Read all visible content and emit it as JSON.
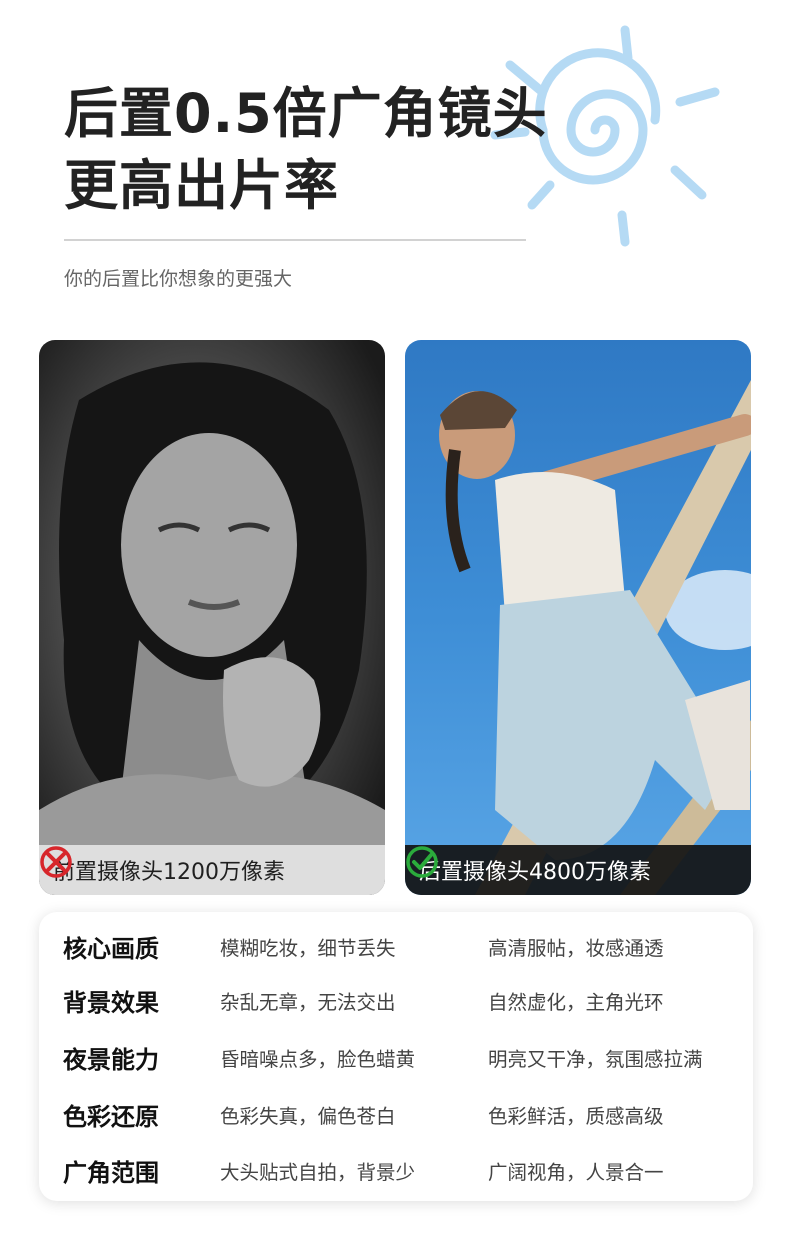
{
  "title": {
    "line1": "后置0.5倍广角镜头",
    "line2": "更高出片率"
  },
  "subtitle": "你的后置比你想象的更强大",
  "photos": {
    "left": {
      "caption": "前置摄像头1200万像素",
      "icon": "cross-mark-icon"
    },
    "right": {
      "caption": "后置摄像头4800万像素",
      "icon": "check-mark-icon"
    }
  },
  "comparison": [
    {
      "label": "核心画质",
      "front": "模糊吃妆，细节丢失",
      "rear": "高清服帖，妆感通透"
    },
    {
      "label": "背景效果",
      "front": "杂乱无章，无法交出",
      "rear": "自然虚化，主角光环"
    },
    {
      "label": "夜景能力",
      "front": "昏暗噪点多，脸色蜡黄",
      "rear": "明亮又干净，氛围感拉满"
    },
    {
      "label": "色彩还原",
      "front": "色彩失真，偏色苍白",
      "rear": "色彩鲜活，质感高级"
    },
    {
      "label": "广角范围",
      "front": "大头贴式自拍，背景少",
      "rear": "广阔视角，人景合一"
    }
  ],
  "colors": {
    "cross": "#d7262b",
    "check": "#2bab3c",
    "sun": "#a9d4f3"
  }
}
